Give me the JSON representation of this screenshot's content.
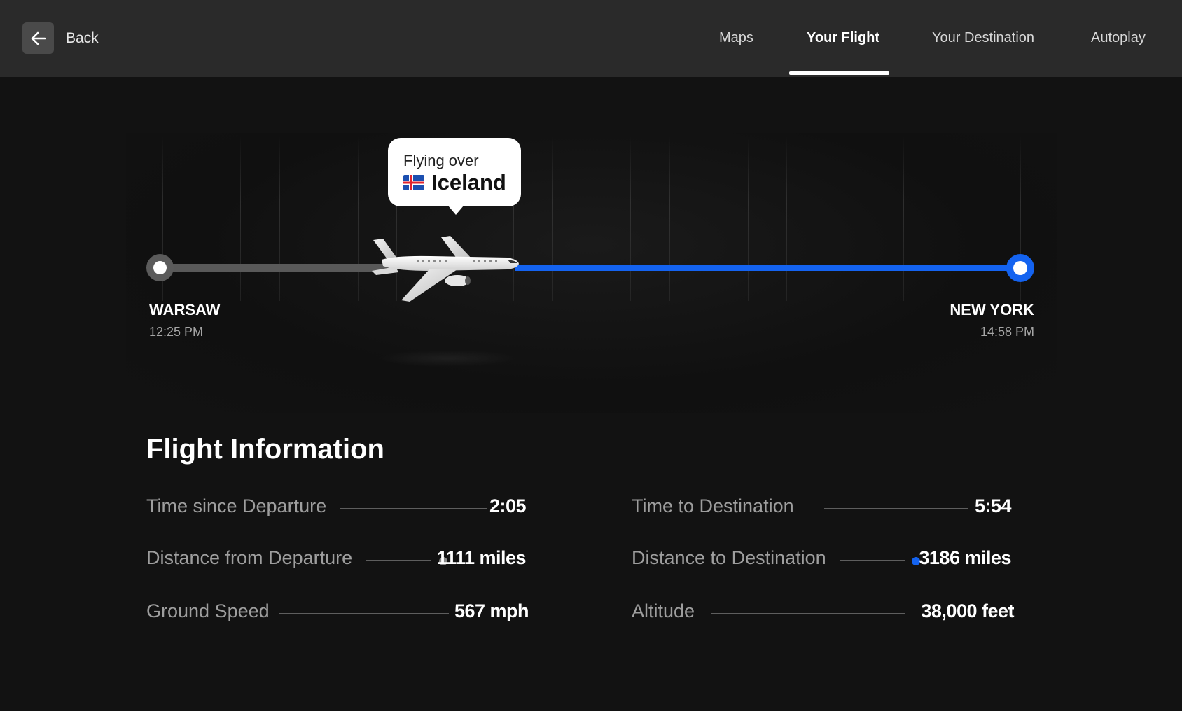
{
  "header": {
    "back_label": "Back",
    "tabs": [
      {
        "label": "Maps",
        "active": false
      },
      {
        "label": "Your Flight",
        "active": true
      },
      {
        "label": "Your Destination",
        "active": false
      },
      {
        "label": "Autoplay",
        "active": false
      }
    ]
  },
  "flight": {
    "progress_fraction": 0.26,
    "bubble": {
      "prefix": "Flying over",
      "country": "Iceland",
      "flag_icon": "iceland-flag-icon"
    },
    "origin": {
      "city": "WARSAW",
      "time": "12:25 PM"
    },
    "destination": {
      "city": "NEW YORK",
      "time": "14:58 PM"
    },
    "colors": {
      "completed_track": "#595959",
      "remaining_track": "#1463f0"
    }
  },
  "info": {
    "title": "Flight Information",
    "left": [
      {
        "label": "Time since Departure",
        "value": "2:05"
      },
      {
        "label": "Distance from Departure",
        "value": "1111 miles",
        "dot": "#8a8a8a"
      },
      {
        "label": "Ground Speed",
        "value": "567 mph"
      }
    ],
    "right": [
      {
        "label": "Time to Destination",
        "value": "5:54"
      },
      {
        "label": "Distance to Destination",
        "value": "3186 miles",
        "dot": "#1463f0"
      },
      {
        "label": "Altitude",
        "value": "38,000 feet"
      }
    ]
  }
}
